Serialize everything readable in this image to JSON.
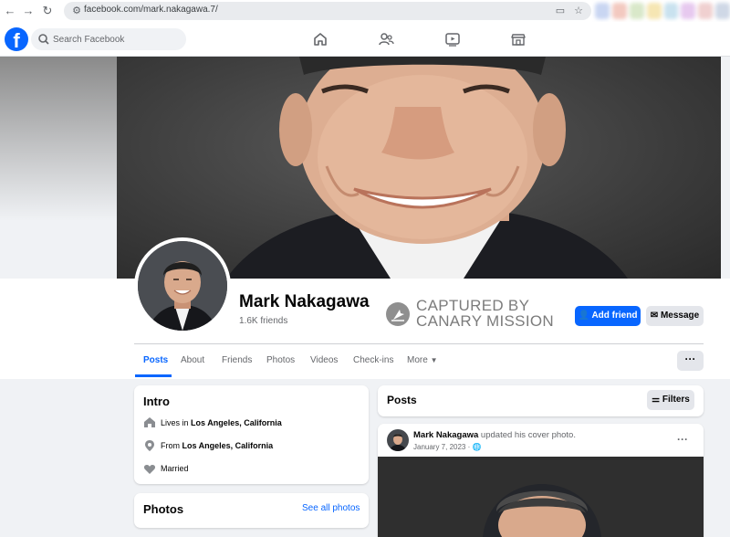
{
  "browser": {
    "url": "facebook.com/mark.nakagawa.7/",
    "nav": {
      "back": "←",
      "forward": "→",
      "reload": "↻"
    },
    "extension_colors": [
      "#c9d6f2",
      "#f3c9c0",
      "#d9e8c9",
      "#f6e6b3",
      "#c9e2ef",
      "#e7c9ef",
      "#f0d0d0",
      "#cfd8e6"
    ]
  },
  "fb": {
    "logo": "f",
    "search_placeholder": "Search Facebook",
    "brand_color": "#0866ff"
  },
  "profile": {
    "name": "Mark Nakagawa",
    "friends": "1.6K friends",
    "watermark_line1": "CAPTURED BY",
    "watermark_line2": "CANARY MISSION",
    "add_friend": "Add friend",
    "message": "Message",
    "tabs": [
      "Posts",
      "About",
      "Friends",
      "Photos",
      "Videos",
      "Check-ins",
      "More"
    ],
    "more_dots": "···"
  },
  "intro": {
    "title": "Intro",
    "lives_prefix": "Lives in ",
    "lives_place": "Los Angeles, California",
    "from_prefix": "From ",
    "from_place": "Los Angeles, California",
    "relationship": "Married"
  },
  "photos": {
    "title": "Photos",
    "see_all": "See all photos"
  },
  "posts": {
    "title": "Posts",
    "filters": "Filters",
    "post_author": "Mark Nakagawa",
    "post_action": " updated his cover photo.",
    "post_date": "January 7, 2023",
    "post_dot": "·",
    "post_menu": "···"
  }
}
